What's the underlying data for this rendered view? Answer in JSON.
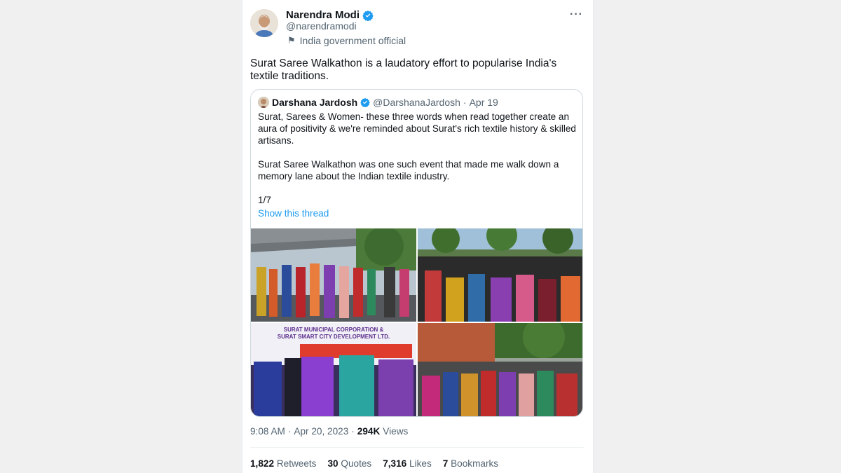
{
  "author": {
    "name": "Narendra Modi",
    "handle": "@narendramodi",
    "affiliation": "India government official"
  },
  "tweet": {
    "text": "Surat Saree Walkathon is a laudatory effort to popularise India's textile traditions."
  },
  "quote": {
    "name": "Darshana Jardosh",
    "handle": "@DarshanaJardosh",
    "separator": "·",
    "date": "Apr 19",
    "paragraph1": "Surat, Sarees & Women- these three words when read together create an aura of positivity & we're reminded about Surat's rich textile history & skilled artisans.",
    "paragraph2": "Surat Saree Walkathon was one such event that made me walk down a memory lane about the Indian textile industry.",
    "paragraph3": "1/7",
    "show_thread": "Show this thread",
    "banner_line1": "SURAT MUNICIPAL CORPORATION &",
    "banner_line2": "SURAT SMART CITY DEVELOPMENT LTD."
  },
  "meta": {
    "time": "9:08 AM",
    "sep": "·",
    "date": "Apr 20, 2023",
    "sep2": "·",
    "views_count": "294K",
    "views_label": "Views"
  },
  "stats": [
    {
      "count": "1,822",
      "label": "Retweets"
    },
    {
      "count": "30",
      "label": "Quotes"
    },
    {
      "count": "7,316",
      "label": "Likes"
    },
    {
      "count": "7",
      "label": "Bookmarks"
    }
  ],
  "colors": {
    "link": "#1d9bf0",
    "verified": "#1d9bf0",
    "secondary_text": "#536471"
  },
  "icons": [
    "verified-badge-icon",
    "flag-icon",
    "more-options-icon"
  ]
}
